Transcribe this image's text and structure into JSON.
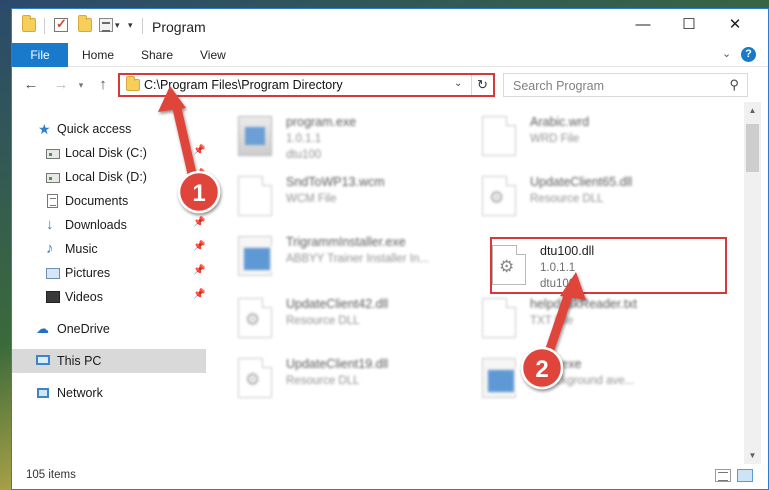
{
  "window": {
    "title": "Program",
    "controls": {
      "minimize": "—",
      "maximize": "☐",
      "close": "✕"
    }
  },
  "ribbon": {
    "tabs": [
      "File",
      "Home",
      "Share",
      "View"
    ]
  },
  "address": {
    "path": "C:\\Program Files\\Program Directory"
  },
  "search": {
    "placeholder": "Search Program"
  },
  "sidebar": {
    "items": [
      {
        "label": "Quick access",
        "icon": "star-icon",
        "pinned": false
      },
      {
        "label": "Local Disk (C:)",
        "icon": "drive-icon",
        "pinned": true
      },
      {
        "label": "Local Disk (D:)",
        "icon": "drive-icon",
        "pinned": true
      },
      {
        "label": "Documents",
        "icon": "documents-icon",
        "pinned": true
      },
      {
        "label": "Downloads",
        "icon": "download-icon",
        "pinned": true
      },
      {
        "label": "Music",
        "icon": "music-icon",
        "pinned": true
      },
      {
        "label": "Pictures",
        "icon": "pictures-icon",
        "pinned": true
      },
      {
        "label": "Videos",
        "icon": "videos-icon",
        "pinned": true
      },
      {
        "label": "OneDrive",
        "icon": "cloud-icon",
        "pinned": false
      },
      {
        "label": "This PC",
        "icon": "computer-icon",
        "pinned": false,
        "selected": true
      },
      {
        "label": "Network",
        "icon": "network-icon",
        "pinned": false
      }
    ]
  },
  "files": [
    {
      "name": "program.exe",
      "line2": "1.0.1.1",
      "line3": "dtu100",
      "icon": "app-icon",
      "blurred": true
    },
    {
      "name": "Arabic.wrd",
      "line2": "WRD File",
      "line3": "",
      "icon": "document-icon",
      "blurred": true
    },
    {
      "name": "SndToWP13.wcm",
      "line2": "WCM File",
      "line3": "",
      "icon": "document-icon",
      "blurred": true
    },
    {
      "name": "UpdateClient65.dll",
      "line2": "Resource DLL",
      "line3": "",
      "icon": "dll-icon",
      "blurred": true
    },
    {
      "name": "TrigrammInstaller.exe",
      "line2": "ABBYY Trainer Installer In...",
      "line3": "",
      "icon": "installer-icon",
      "blurred": true
    },
    {
      "name": "dtu100.dll",
      "line2": "1.0.1.1",
      "line3": "dtu100",
      "icon": "dll-icon",
      "blurred": false
    },
    {
      "name": "UpdateClient42.dll",
      "line2": "Resource DLL",
      "line3": "",
      "icon": "dll-icon",
      "blurred": true
    },
    {
      "name": "helpdeskReader.txt",
      "line2": "TXT File",
      "line3": "",
      "icon": "document-icon",
      "blurred": true
    },
    {
      "name": "UpdateClient19.dll",
      "line2": "Resource DLL",
      "line3": "",
      "icon": "dll-icon",
      "blurred": true
    },
    {
      "name": "Exec.exe",
      "line2": "... background ave...",
      "line3": "",
      "icon": "installer-icon",
      "blurred": true
    }
  ],
  "status": {
    "item_count": "105 items"
  },
  "annotations": {
    "step1": "1",
    "step2": "2",
    "color": "#e0453a"
  }
}
